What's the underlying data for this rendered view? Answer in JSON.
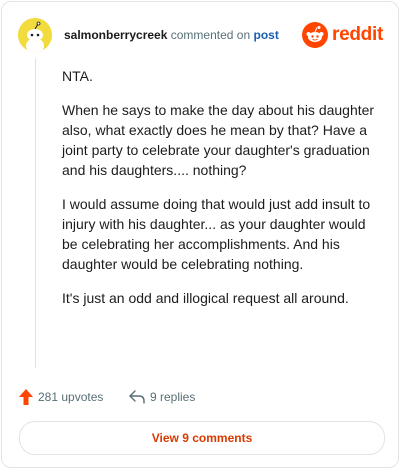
{
  "comment": {
    "username": "salmonberrycreek",
    "action_text": "commented on",
    "post_link": "post",
    "avatar_icon": "snoo-avatar-icon",
    "body": [
      "NTA.",
      "When he says to make the day about his daughter also, what exactly does he mean by that? Have a joint party to celebrate your daughter's graduation and his daughters.... nothing?",
      "I would assume doing that would just add insult to injury with his daughter... as your daughter would be celebrating her accomplishments. And his daughter would be celebrating nothing.",
      "It's just an odd and illogical request all around."
    ]
  },
  "brand": {
    "wordmark": "reddit",
    "icon": "reddit-logo-icon",
    "color": "#ff4500"
  },
  "footer": {
    "upvotes": "281 upvotes",
    "upvote_icon": "upvote-arrow-icon",
    "replies": "9 replies",
    "reply_icon": "reply-arrow-icon",
    "view_button": "View 9 comments"
  },
  "colors": {
    "accent": "#ff4500",
    "link": "#1a5fb4",
    "muted": "#576f76",
    "view_button_text": "#d93a00",
    "avatar_bg": "#f2dc3d"
  }
}
